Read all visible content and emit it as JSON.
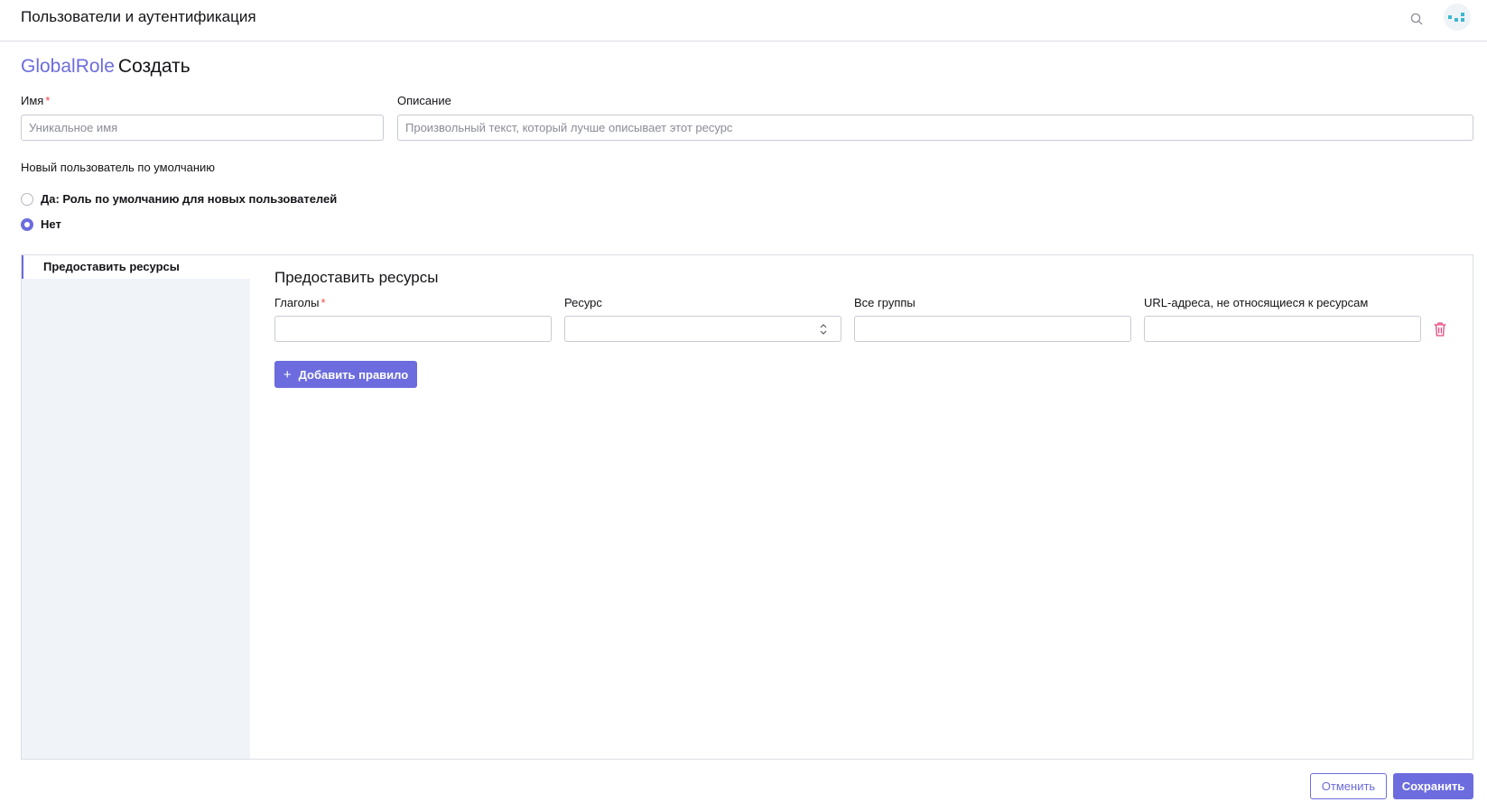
{
  "header": {
    "title": "Пользователи и аутентификация"
  },
  "page": {
    "resource": "GlobalRole",
    "action": "Создать"
  },
  "form": {
    "name": {
      "label": "Имя",
      "required_mark": "*",
      "placeholder": "Уникальное имя",
      "value": ""
    },
    "description": {
      "label": "Описание",
      "placeholder": "Произвольный текст, который лучше описывает этот ресурс",
      "value": ""
    },
    "new_user_default": {
      "label": "Новый пользователь по умолчанию",
      "options": [
        {
          "label": "Да: Роль по умолчанию для новых пользователей",
          "checked": false
        },
        {
          "label": "Нет",
          "checked": true
        }
      ]
    }
  },
  "tabs": [
    {
      "label": "Предоставить ресурсы",
      "active": true
    }
  ],
  "rules_section": {
    "title": "Предоставить ресурсы",
    "columns": {
      "verbs": "Глаголы",
      "verbs_required": "*",
      "resource": "Ресурс",
      "all_groups": "Все группы",
      "non_resource_urls": "URL-адреса, не относящиеся к ресурсам"
    },
    "rows": [
      {
        "verbs": "",
        "resource": "",
        "groups": "",
        "urls": ""
      }
    ],
    "add_rule_label": "Добавить правило",
    "add_rule_icon": "+"
  },
  "footer": {
    "cancel_label": "Отменить",
    "save_label": "Сохранить"
  },
  "colors": {
    "accent": "#6c6cde",
    "required": "#f64747",
    "danger_icon": "#e5467d",
    "sidebar_bg": "#f0f3f8",
    "logo_teal": "#3ab7d2"
  },
  "icons": {
    "search": "search-icon",
    "avatar": "avatar-icon",
    "chevron": "chevron-up-down-icon",
    "trash": "trash-icon"
  }
}
